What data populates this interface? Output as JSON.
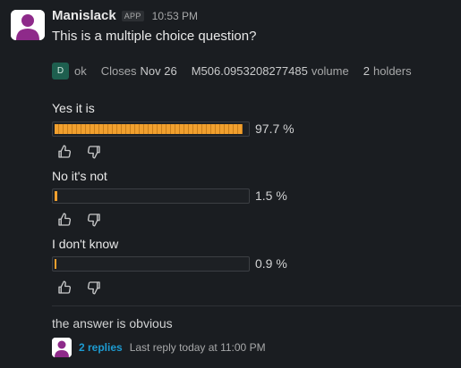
{
  "message": {
    "sender": "Manislack",
    "badge": "APP",
    "time": "10:53 PM",
    "question": "This is a multiple choice question?"
  },
  "meta": {
    "creator_initial": "D",
    "creator_name": "ok",
    "closes_label": "Closes",
    "closes_date": "Nov 26",
    "volume_value": "M506.0953208277485",
    "volume_label": "volume",
    "holders_count": "2",
    "holders_label": "holders"
  },
  "options": [
    {
      "label": "Yes it is",
      "percent_text": "97.7 %",
      "percent": 97.7
    },
    {
      "label": "No it's not",
      "percent_text": "1.5 %",
      "percent": 1.5
    },
    {
      "label": "I don't know",
      "percent_text": "0.9 %",
      "percent": 0.9
    }
  ],
  "icons": {
    "upvote": "thumbs-up-icon",
    "downvote": "thumbs-down-icon"
  },
  "colors": {
    "accent": "#f1a02e",
    "link": "#1d9bd1",
    "background": "#1a1d21"
  },
  "reply": {
    "text": "the answer is obvious",
    "replies_link": "2 replies",
    "last_reply": "Last reply today at 11:00 PM"
  }
}
